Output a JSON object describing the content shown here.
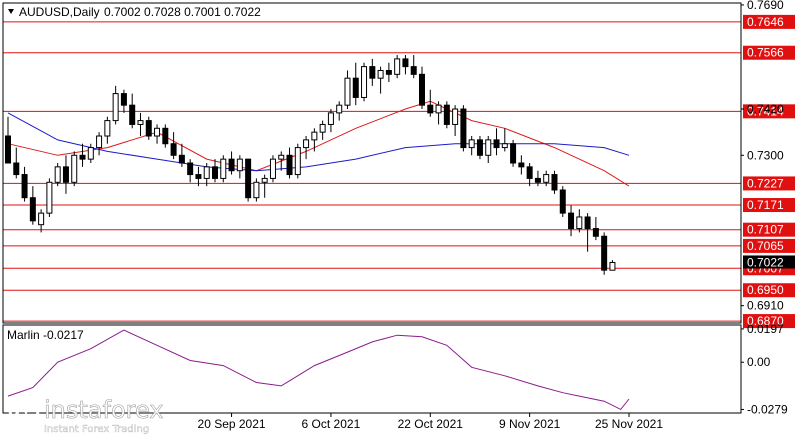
{
  "chart_data": {
    "type": "candlestick",
    "symbol_line": "AUDUSD,Daily",
    "ohlc_line": "0.7002 0.7028 0.7001 0.7022",
    "price_axis": {
      "range": [
        0.6865,
        0.7695
      ],
      "ticks": [
        "0.7690",
        "0.7420",
        "0.7300",
        "0.6910"
      ]
    },
    "levels": [
      {
        "value": 0.7646,
        "label": "0.7646"
      },
      {
        "value": 0.7566,
        "label": "0.7566"
      },
      {
        "value": 0.7414,
        "label": "0.7414"
      },
      {
        "value": 0.7227,
        "label": "0.7227"
      },
      {
        "value": 0.7171,
        "label": "0.7171"
      },
      {
        "value": 0.7107,
        "label": "0.7107"
      },
      {
        "value": 0.7065,
        "label": "0.7065"
      },
      {
        "value": 0.7007,
        "label": "0.7007"
      },
      {
        "value": 0.695,
        "label": "0.6950"
      },
      {
        "value": 0.687,
        "label": "0.6870"
      }
    ],
    "current_price": {
      "value": 0.7022,
      "label": "0.7022"
    },
    "x_labels": [
      {
        "index": 27,
        "label": "20 Sep 2021"
      },
      {
        "index": 39,
        "label": "6 Oct 2021"
      },
      {
        "index": 51,
        "label": "22 Oct 2021"
      },
      {
        "index": 63,
        "label": "9 Nov 2021"
      },
      {
        "index": 75,
        "label": "25 Nov 2021"
      }
    ],
    "candles": [
      [
        0.735,
        0.74,
        0.729,
        0.728
      ],
      [
        0.728,
        0.732,
        0.724,
        0.725
      ],
      [
        0.725,
        0.727,
        0.718,
        0.719
      ],
      [
        0.719,
        0.722,
        0.712,
        0.713
      ],
      [
        0.712,
        0.716,
        0.71,
        0.715
      ],
      [
        0.715,
        0.724,
        0.714,
        0.723
      ],
      [
        0.723,
        0.728,
        0.722,
        0.727
      ],
      [
        0.727,
        0.73,
        0.72,
        0.723
      ],
      [
        0.723,
        0.731,
        0.722,
        0.73
      ],
      [
        0.73,
        0.733,
        0.727,
        0.729
      ],
      [
        0.729,
        0.733,
        0.728,
        0.732
      ],
      [
        0.732,
        0.736,
        0.73,
        0.735
      ],
      [
        0.735,
        0.74,
        0.733,
        0.739
      ],
      [
        0.739,
        0.748,
        0.738,
        0.746
      ],
      [
        0.746,
        0.747,
        0.741,
        0.743
      ],
      [
        0.743,
        0.746,
        0.737,
        0.738
      ],
      [
        0.738,
        0.741,
        0.735,
        0.739
      ],
      [
        0.739,
        0.74,
        0.734,
        0.735
      ],
      [
        0.735,
        0.738,
        0.733,
        0.737
      ],
      [
        0.737,
        0.738,
        0.732,
        0.733
      ],
      [
        0.733,
        0.736,
        0.729,
        0.73
      ],
      [
        0.73,
        0.733,
        0.727,
        0.728
      ],
      [
        0.728,
        0.729,
        0.723,
        0.725
      ],
      [
        0.725,
        0.727,
        0.722,
        0.724
      ],
      [
        0.724,
        0.728,
        0.722,
        0.727
      ],
      [
        0.727,
        0.729,
        0.723,
        0.724
      ],
      [
        0.724,
        0.73,
        0.723,
        0.729
      ],
      [
        0.729,
        0.731,
        0.725,
        0.726
      ],
      [
        0.726,
        0.73,
        0.724,
        0.729
      ],
      [
        0.729,
        0.729,
        0.718,
        0.719
      ],
      [
        0.719,
        0.724,
        0.718,
        0.723
      ],
      [
        0.723,
        0.725,
        0.719,
        0.724
      ],
      [
        0.724,
        0.73,
        0.723,
        0.729
      ],
      [
        0.729,
        0.731,
        0.726,
        0.73
      ],
      [
        0.73,
        0.732,
        0.724,
        0.725
      ],
      [
        0.725,
        0.733,
        0.724,
        0.732
      ],
      [
        0.732,
        0.735,
        0.729,
        0.734
      ],
      [
        0.734,
        0.737,
        0.731,
        0.736
      ],
      [
        0.736,
        0.739,
        0.734,
        0.738
      ],
      [
        0.738,
        0.742,
        0.736,
        0.741
      ],
      [
        0.741,
        0.744,
        0.739,
        0.743
      ],
      [
        0.743,
        0.752,
        0.742,
        0.75
      ],
      [
        0.75,
        0.754,
        0.743,
        0.745
      ],
      [
        0.745,
        0.754,
        0.744,
        0.753
      ],
      [
        0.753,
        0.755,
        0.748,
        0.75
      ],
      [
        0.75,
        0.753,
        0.746,
        0.752
      ],
      [
        0.752,
        0.754,
        0.749,
        0.751
      ],
      [
        0.751,
        0.756,
        0.75,
        0.755
      ],
      [
        0.755,
        0.756,
        0.751,
        0.753
      ],
      [
        0.753,
        0.756,
        0.75,
        0.751
      ],
      [
        0.751,
        0.753,
        0.742,
        0.743
      ],
      [
        0.743,
        0.747,
        0.74,
        0.741
      ],
      [
        0.741,
        0.744,
        0.738,
        0.743
      ],
      [
        0.743,
        0.744,
        0.737,
        0.738
      ],
      [
        0.738,
        0.743,
        0.735,
        0.742
      ],
      [
        0.742,
        0.743,
        0.731,
        0.732
      ],
      [
        0.732,
        0.735,
        0.73,
        0.734
      ],
      [
        0.734,
        0.735,
        0.729,
        0.73
      ],
      [
        0.73,
        0.735,
        0.728,
        0.734
      ],
      [
        0.734,
        0.737,
        0.73,
        0.732
      ],
      [
        0.732,
        0.737,
        0.731,
        0.733
      ],
      [
        0.733,
        0.734,
        0.727,
        0.728
      ],
      [
        0.728,
        0.73,
        0.725,
        0.727
      ],
      [
        0.727,
        0.728,
        0.722,
        0.724
      ],
      [
        0.724,
        0.726,
        0.722,
        0.723
      ],
      [
        0.723,
        0.726,
        0.722,
        0.725
      ],
      [
        0.725,
        0.726,
        0.72,
        0.721
      ],
      [
        0.721,
        0.722,
        0.714,
        0.715
      ],
      [
        0.715,
        0.717,
        0.709,
        0.711
      ],
      [
        0.711,
        0.716,
        0.71,
        0.714
      ],
      [
        0.714,
        0.715,
        0.705,
        0.711
      ],
      [
        0.711,
        0.714,
        0.708,
        0.709
      ],
      [
        0.709,
        0.71,
        0.699,
        0.7002
      ],
      [
        0.7002,
        0.7028,
        0.7001,
        0.7022
      ]
    ],
    "moving_averages": [
      {
        "color": "#dd1c1c",
        "points": [
          [
            0,
            0.733
          ],
          [
            6,
            0.73
          ],
          [
            12,
            0.732
          ],
          [
            18,
            0.736
          ],
          [
            24,
            0.729
          ],
          [
            30,
            0.726
          ],
          [
            36,
            0.731
          ],
          [
            42,
            0.737
          ],
          [
            48,
            0.742
          ],
          [
            51,
            0.744
          ],
          [
            56,
            0.739
          ],
          [
            60,
            0.737
          ],
          [
            66,
            0.732
          ],
          [
            72,
            0.726
          ],
          [
            75,
            0.722
          ]
        ]
      },
      {
        "color": "#1c1cc8",
        "points": [
          [
            0,
            0.741
          ],
          [
            6,
            0.734
          ],
          [
            12,
            0.731
          ],
          [
            18,
            0.729
          ],
          [
            24,
            0.727
          ],
          [
            30,
            0.726
          ],
          [
            36,
            0.727
          ],
          [
            42,
            0.729
          ],
          [
            48,
            0.732
          ],
          [
            54,
            0.733
          ],
          [
            60,
            0.733
          ],
          [
            66,
            0.733
          ],
          [
            72,
            0.732
          ],
          [
            75,
            0.73
          ]
        ]
      }
    ],
    "oscillator": {
      "name": "Marlin -0.0217",
      "range": [
        -0.03,
        0.022
      ],
      "ticks": [
        "0.0197",
        "0.00",
        "-0.0279"
      ],
      "color": "#8b1c8b",
      "points": [
        [
          0,
          -0.02
        ],
        [
          3,
          -0.015
        ],
        [
          6,
          0.0
        ],
        [
          10,
          0.008
        ],
        [
          14,
          0.019
        ],
        [
          18,
          0.01
        ],
        [
          22,
          0.001
        ],
        [
          26,
          -0.002
        ],
        [
          30,
          -0.012
        ],
        [
          33,
          -0.014
        ],
        [
          37,
          -0.002
        ],
        [
          41,
          0.006
        ],
        [
          44,
          0.012
        ],
        [
          47,
          0.016
        ],
        [
          50,
          0.015
        ],
        [
          53,
          0.01
        ],
        [
          56,
          -0.003
        ],
        [
          60,
          -0.008
        ],
        [
          64,
          -0.014
        ],
        [
          67,
          -0.018
        ],
        [
          69,
          -0.02
        ],
        [
          72,
          -0.023
        ],
        [
          74,
          -0.0279
        ],
        [
          75,
          -0.0217
        ]
      ]
    }
  },
  "watermark": {
    "brand": "instaforex",
    "tagline": "Instant Forex Trading"
  }
}
